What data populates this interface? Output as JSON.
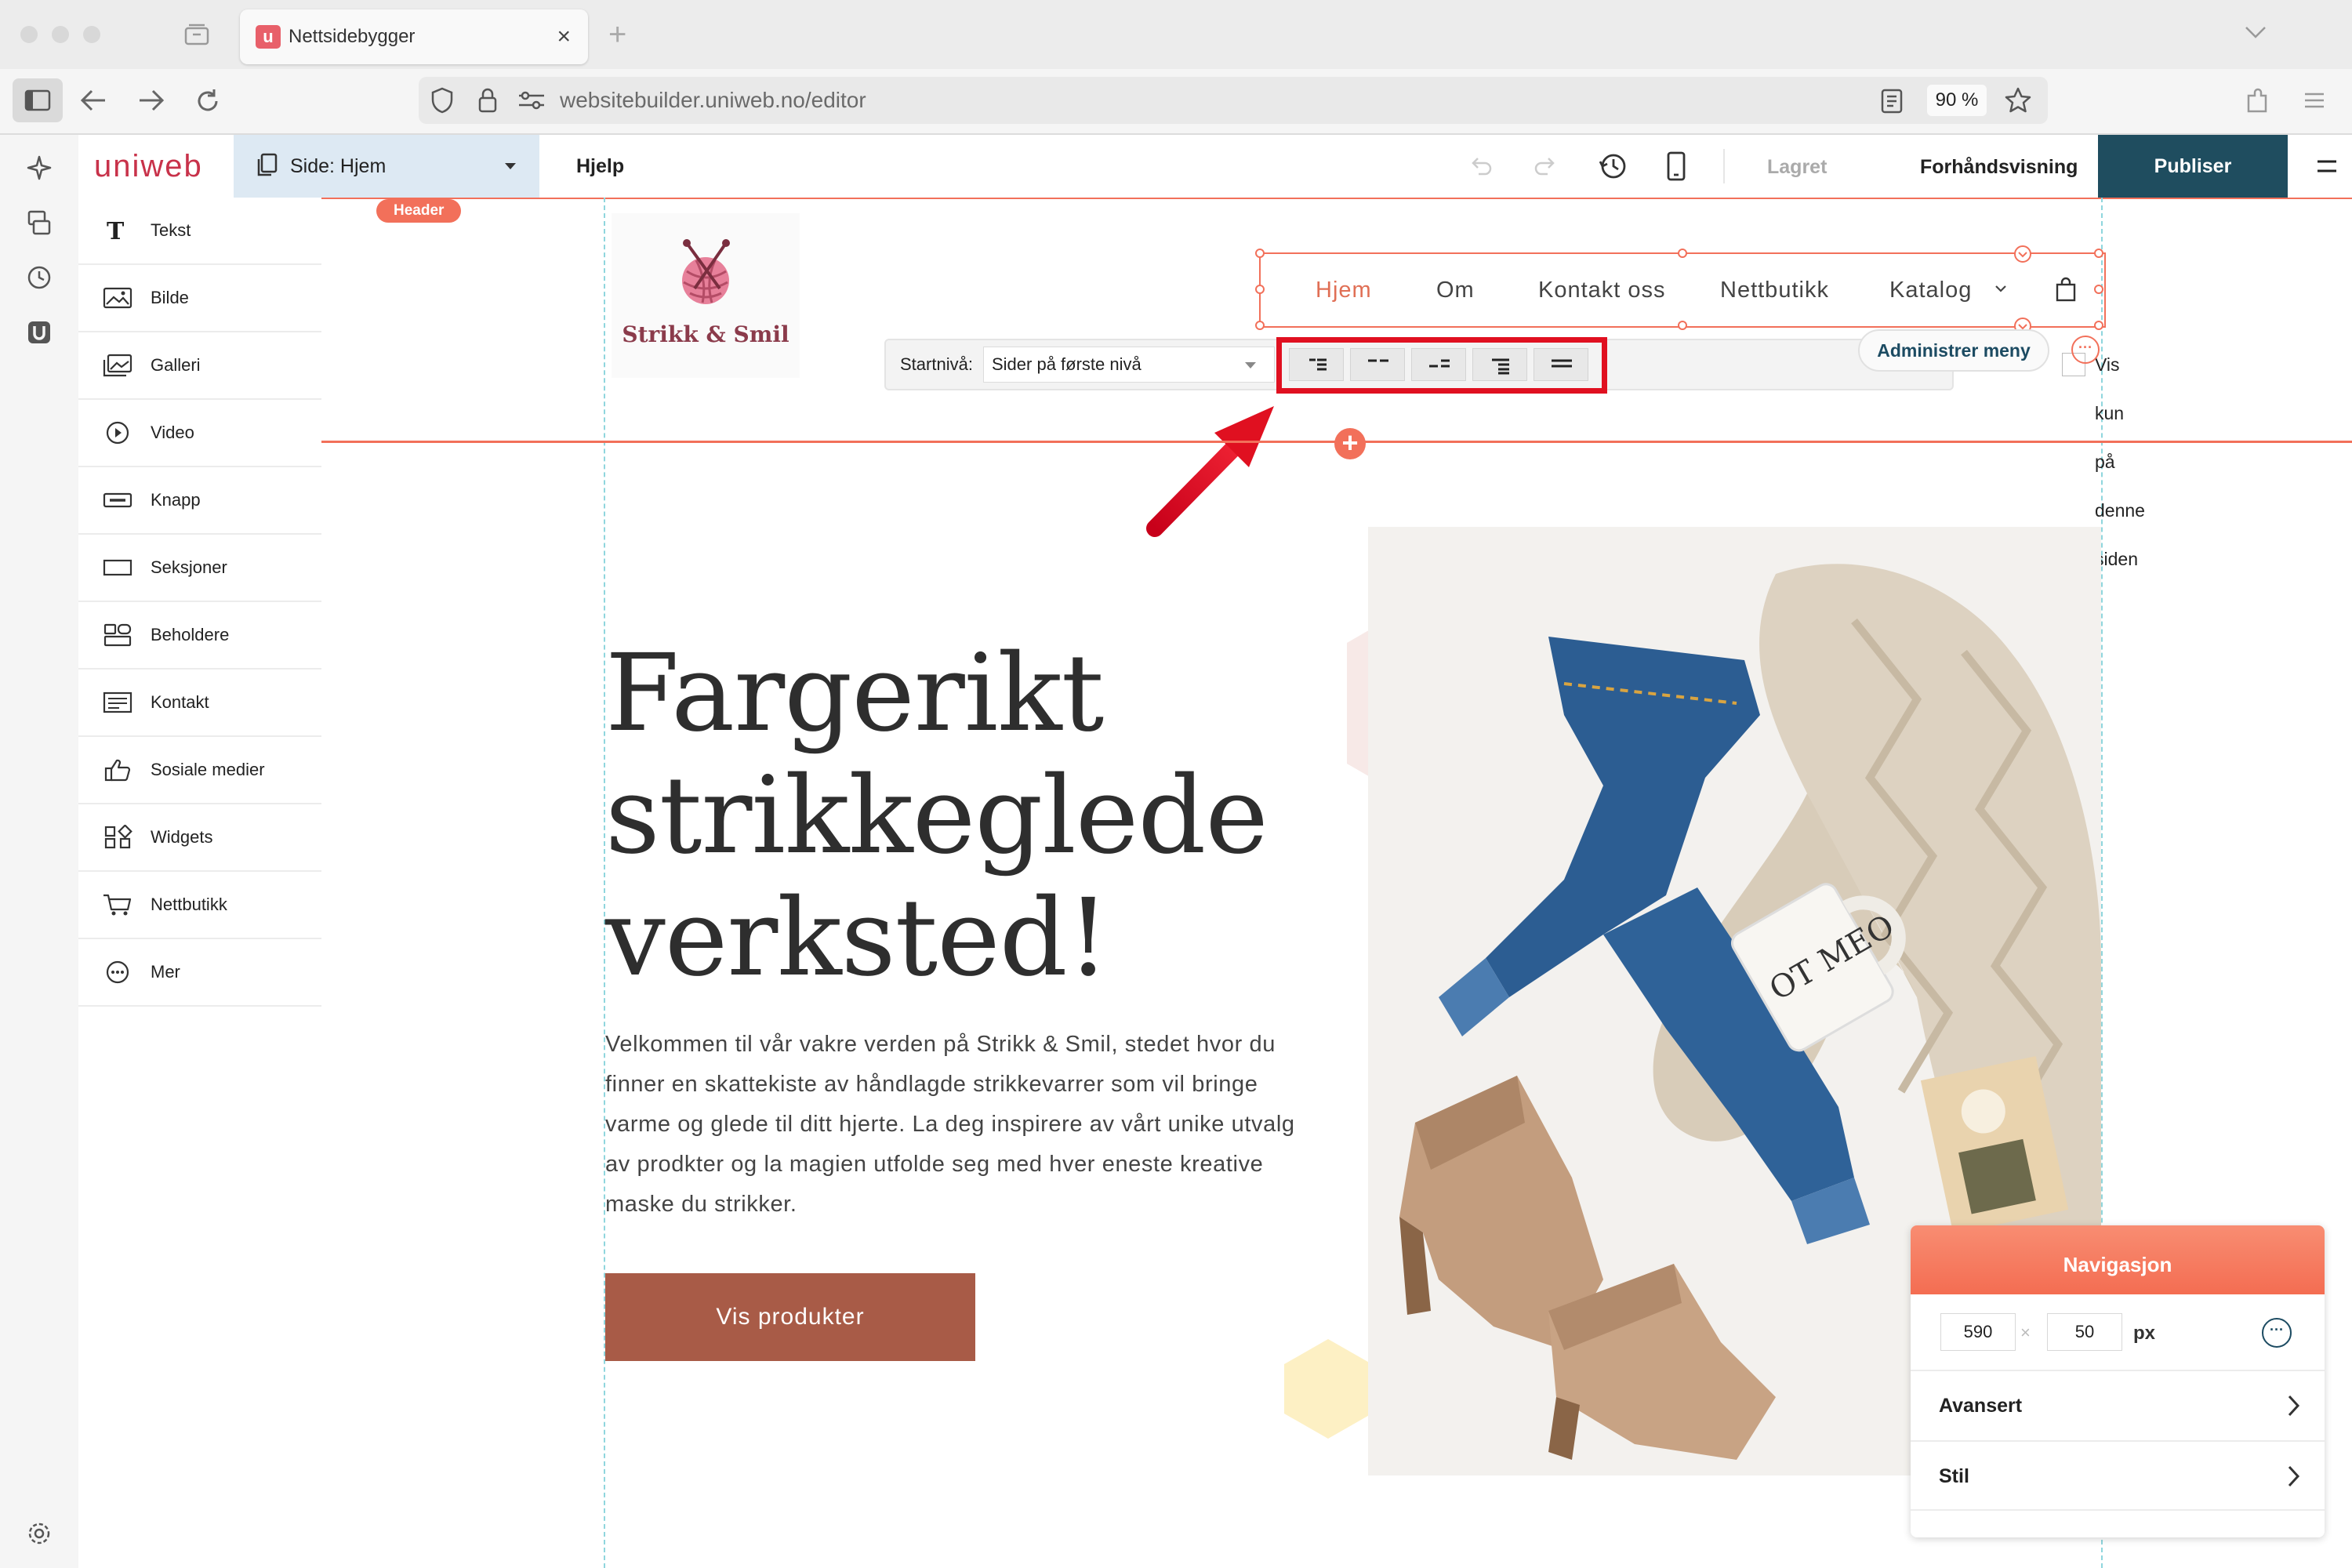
{
  "browser": {
    "tab_title": "Nettsidebygger",
    "tab_favicon": "u",
    "tab_close": "×",
    "new_tab": "+",
    "url": "websitebuilder.uniweb.no/editor",
    "zoom": "90 %"
  },
  "editor": {
    "brand": "uniweb",
    "page_select_label": "Side: Hjem",
    "help": "Hjelp",
    "saved": "Lagret",
    "preview": "Forhåndsvisning",
    "publish": "Publiser"
  },
  "elements": [
    {
      "label": "Tekst",
      "icon": "text-icon"
    },
    {
      "label": "Bilde",
      "icon": "image-icon"
    },
    {
      "label": "Galleri",
      "icon": "gallery-icon"
    },
    {
      "label": "Video",
      "icon": "video-icon"
    },
    {
      "label": "Knapp",
      "icon": "button-icon"
    },
    {
      "label": "Seksjoner",
      "icon": "sections-icon"
    },
    {
      "label": "Beholdere",
      "icon": "containers-icon"
    },
    {
      "label": "Kontakt",
      "icon": "contact-icon"
    },
    {
      "label": "Sosiale medier",
      "icon": "thumbs-up-icon"
    },
    {
      "label": "Widgets",
      "icon": "widgets-icon"
    },
    {
      "label": "Nettbutikk",
      "icon": "cart-icon"
    },
    {
      "label": "Mer",
      "icon": "more-icon"
    }
  ],
  "canvas": {
    "header_badge": "Header",
    "logo_text": "Strikk & Smil",
    "nav_links": [
      "Hjem",
      "Om",
      "Kontakt oss",
      "Nettbutikk",
      "Katalog"
    ],
    "nav_toolbar": {
      "start_level_label": "Startnivå:",
      "start_level_value": "Sider på første nivå",
      "show_only_label": "Vis kun på denne siden",
      "show_only_checked": false,
      "manage_menu": "Administrer meny"
    },
    "hero": {
      "title": "Fargerikt strikkeglede verksted!",
      "body": "Velkommen til vår vakre verden på Strikk & Smil, stedet hvor du finner en skattekiste av håndlagde strikkevarrer som vil bringe varme og glede til ditt hjerte. La deg inspirere av vårt unike utvalg av prodkter og la magien utfolde seg med hver eneste kreative maske du strikker.",
      "cta": "Vis produkter",
      "photo_mug_text": "OT MEO"
    }
  },
  "properties_panel": {
    "title": "Navigasjon",
    "width": "590",
    "height": "50",
    "times": "×",
    "unit": "px",
    "rows": [
      "Avansert",
      "Stil"
    ]
  },
  "colors": {
    "accent": "#f2705a",
    "publish_bg": "#1f4d5f",
    "cta_bg": "#a85b47",
    "highlight_red": "#e01020",
    "brand": "#c8324a"
  }
}
